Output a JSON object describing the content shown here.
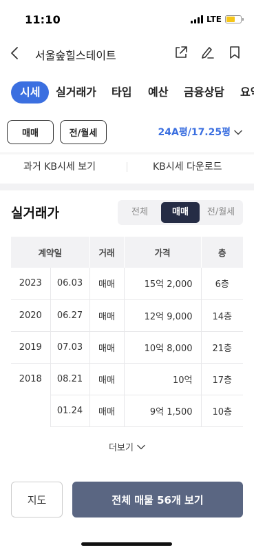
{
  "status_bar": {
    "time": "11:10",
    "network": "LTE",
    "battery_color": "#f5c518"
  },
  "header": {
    "title": "서울숲힐스테이트",
    "icons": [
      "back-icon",
      "share-icon",
      "edit-icon",
      "bookmark-icon"
    ]
  },
  "tabs": [
    {
      "label": "시세",
      "active": true
    },
    {
      "label": "실거래가"
    },
    {
      "label": "타입"
    },
    {
      "label": "예산"
    },
    {
      "label": "금융상담"
    },
    {
      "label": "요약"
    }
  ],
  "filters": {
    "trade_type": "매매",
    "rent_type": "전/월세",
    "area": "24A평/17.25평"
  },
  "kb_links": {
    "past": "과거 KB시세 보기",
    "download": "KB시세 다운로드"
  },
  "transactions": {
    "title": "실거래가",
    "segments": [
      {
        "label": "전체"
      },
      {
        "label": "매매",
        "active": true
      },
      {
        "label": "전/월세"
      }
    ],
    "columns": [
      "계약일",
      "거래",
      "가격",
      "층"
    ],
    "rows": [
      {
        "year": "2023",
        "date": "06.03",
        "type": "매매",
        "price": "15억 2,000",
        "floor": "6층"
      },
      {
        "year": "2020",
        "date": "06.27",
        "type": "매매",
        "price": "12억 9,000",
        "floor": "14층"
      },
      {
        "year": "2019",
        "date": "07.03",
        "type": "매매",
        "price": "10억 8,000",
        "floor": "21층"
      },
      {
        "year": "2018",
        "date": "08.21",
        "type": "매매",
        "price": "10억",
        "floor": "17층"
      },
      {
        "year": "",
        "date": "01.24",
        "type": "매매",
        "price": "9억 1,500",
        "floor": "10층"
      }
    ],
    "more_label": "더보기"
  },
  "bottom": {
    "map_label": "지도",
    "all_listings_label": "전체 매물 56개 보기"
  },
  "colors": {
    "accent": "#3b6fe0",
    "segment_active": "#252c45",
    "cta": "#5a6682"
  }
}
